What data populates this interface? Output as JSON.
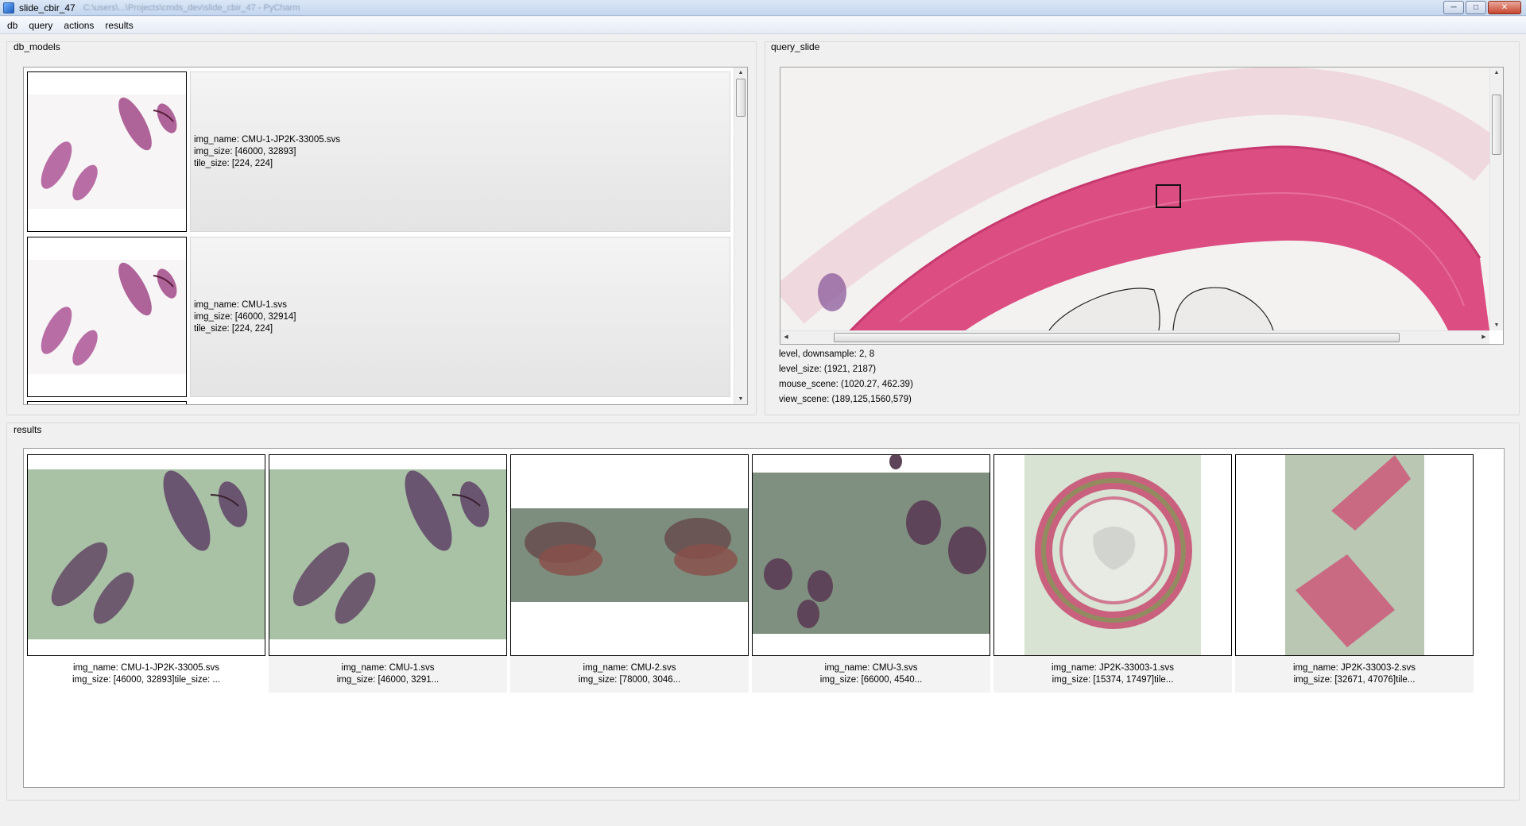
{
  "window": {
    "title": "slide_cbir_47",
    "path": "C:\\users\\...\\Projects\\cmds_dev\\slide_cbir_47 - PyCharm"
  },
  "menu": [
    "db",
    "query",
    "actions",
    "results"
  ],
  "db_models": {
    "label": "db_models",
    "items": [
      {
        "img_name": "img_name: CMU-1-JP2K-33005.svs",
        "img_size": "img_size: [46000, 32893]",
        "tile_size": "tile_size: [224, 224]"
      },
      {
        "img_name": "img_name: CMU-1.svs",
        "img_size": "img_size: [46000, 32914]",
        "tile_size": "tile_size: [224, 224]"
      }
    ]
  },
  "query_slide": {
    "label": "query_slide",
    "level_downsample": "level, downsample: 2, 8",
    "level_size": "level_size: (1921, 2187)",
    "mouse_scene": "mouse_scene: (1020.27, 462.39)",
    "view_scene": "view_scene: (189,125,1560,579)"
  },
  "results": {
    "label": "results",
    "items": [
      {
        "line1": "img_name: CMU-1-JP2K-33005.svs",
        "line2": "img_size: [46000, 32893]tile_size: ..."
      },
      {
        "line1": "img_name: CMU-1.svs",
        "line2": "img_size: [46000, 3291..."
      },
      {
        "line1": "img_name: CMU-2.svs",
        "line2": "img_size: [78000, 3046..."
      },
      {
        "line1": "img_name: CMU-3.svs",
        "line2": "img_size: [66000, 4540..."
      },
      {
        "line1": "img_name: JP2K-33003-1.svs",
        "line2": "img_size: [15374, 17497]tile..."
      },
      {
        "line1": "img_name: JP2K-33003-2.svs",
        "line2": "img_size: [32671, 47076]tile..."
      }
    ]
  },
  "colors": {
    "tissue_pink": "#d9487e",
    "tissue_purple": "#9a4f8f",
    "tile_green": "#a9c2a6"
  }
}
